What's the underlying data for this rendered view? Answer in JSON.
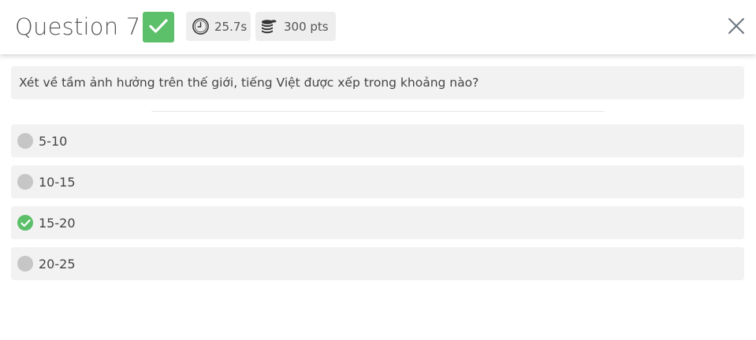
{
  "header": {
    "title": "Question 7",
    "status": "correct",
    "status_color": "#5cbf6a",
    "time_icon": "clock-icon",
    "time": "25.7s",
    "points_icon": "coins-icon",
    "points": "300 pts",
    "close_icon": "close-icon"
  },
  "question": {
    "text": "Xét về tầm ảnh hưởng trên thế giới, tiếng Việt được xếp trong khoảng nào?"
  },
  "options": [
    {
      "label": "5-10",
      "selected": false
    },
    {
      "label": "10-15",
      "selected": false
    },
    {
      "label": "15-20",
      "selected": true
    },
    {
      "label": "20-25",
      "selected": false
    }
  ]
}
